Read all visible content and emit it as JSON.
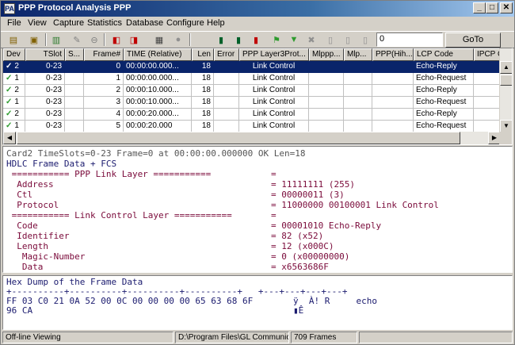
{
  "window": {
    "title": "PPP Protocol Analysis PPP",
    "app_icon_text": "PA"
  },
  "menu": [
    "File",
    "View",
    "Capture",
    "Statistics",
    "Database",
    "Configure",
    "Help"
  ],
  "toolbar": {
    "frame_input_value": "0",
    "goto_label": "GoTo",
    "icons": [
      "open-file",
      "open-folder",
      "filter",
      "pencil",
      "stop",
      "capture-1",
      "capture-2",
      "table",
      "sphere",
      "frames-1",
      "frames-2",
      "frames-3",
      "set-filter",
      "funnel",
      "cross",
      "cfg",
      "cfg-2",
      "cfg-3"
    ],
    "icon_glyphs": [
      "▤",
      "▣",
      "▥",
      "✎",
      "⊖",
      "◧",
      "◨",
      "▦",
      "●",
      "▮",
      "▮",
      "▮",
      "⚑",
      "▼",
      "✖",
      "▯",
      "▯",
      "▯"
    ]
  },
  "grid": {
    "columns": [
      "Dev",
      "TSlot",
      "S...",
      "Frame#",
      "TIME (Relative)",
      "Len",
      "Error",
      "PPP Layer3Prot...",
      "Mlppp...",
      "Mlp...",
      "PPP(Hih...",
      "LCP Code",
      "IPCP C"
    ],
    "rows": [
      {
        "dev": "2",
        "tslot": "0-23",
        "s": "",
        "frame": "0",
        "time": "00:00:00.000...",
        "len": "18",
        "error": "",
        "proto": "Link Control",
        "code": "Echo-Reply",
        "selected": true
      },
      {
        "dev": "1",
        "tslot": "0-23",
        "s": "",
        "frame": "1",
        "time": "00:00:00.000...",
        "len": "18",
        "error": "",
        "proto": "Link Control",
        "code": "Echo-Request",
        "selected": false
      },
      {
        "dev": "2",
        "tslot": "0-23",
        "s": "",
        "frame": "2",
        "time": "00:00:10.000...",
        "len": "18",
        "error": "",
        "proto": "Link Control",
        "code": "Echo-Reply",
        "selected": false
      },
      {
        "dev": "1",
        "tslot": "0-23",
        "s": "",
        "frame": "3",
        "time": "00:00:10.000...",
        "len": "18",
        "error": "",
        "proto": "Link Control",
        "code": "Echo-Request",
        "selected": false
      },
      {
        "dev": "2",
        "tslot": "0-23",
        "s": "",
        "frame": "4",
        "time": "00:00:20.000...",
        "len": "18",
        "error": "",
        "proto": "Link Control",
        "code": "Echo-Reply",
        "selected": false
      },
      {
        "dev": "1",
        "tslot": "0-23",
        "s": "",
        "frame": "5",
        "time": "00:00:20.000",
        "len": "18",
        "error": "",
        "proto": "Link Control",
        "code": "Echo-Request",
        "selected": false
      }
    ]
  },
  "decode": {
    "lines": [
      {
        "label": "Card2 TimeSlots=0-23 Frame=0 at 00:00:00.000000 OK Len=18",
        "value": "",
        "style": "hdrline"
      },
      {
        "label": "HDLC Frame Data + FCS",
        "value": "",
        "style": "navy"
      },
      {
        "label": " =========== PPP Link Layer ===========",
        "value": "=",
        "style": ""
      },
      {
        "label": "  Address",
        "value": "= 11111111 (255)",
        "style": ""
      },
      {
        "label": "  Ctl",
        "value": "= 00000011 (3)",
        "style": ""
      },
      {
        "label": "  Protocol",
        "value": "= 11000000 00100001 Link Control",
        "style": ""
      },
      {
        "label": " =========== Link Control Layer ===========",
        "value": "=",
        "style": ""
      },
      {
        "label": "  Code",
        "value": "= 00001010 Echo-Reply",
        "style": ""
      },
      {
        "label": "  Identifier",
        "value": "= 82 (x52)",
        "style": ""
      },
      {
        "label": "  Length",
        "value": "= 12 (x000C)",
        "style": ""
      },
      {
        "label": "   Magic-Number",
        "value": "= 0 (x00000000)",
        "style": ""
      },
      {
        "label": "   Data",
        "value": "= x6563686F",
        "style": ""
      }
    ]
  },
  "hex": {
    "title": "Hex Dump of the Frame Data",
    "ruler": "+----------+----------+----------+----------+   +---+---+---+---+",
    "line1_hex": "FF 03 C0 21 0A 52 00 0C 00 00 00 00 65 63 68 6F",
    "line1_ascii": "ÿ  À! R     echo",
    "line2_hex": "96 CA",
    "line2_ascii": "▮Ê"
  },
  "status": {
    "mode": "Off-line Viewing",
    "path": "D:\\Program Files\\GL Communications",
    "frames": "709 Frames"
  }
}
